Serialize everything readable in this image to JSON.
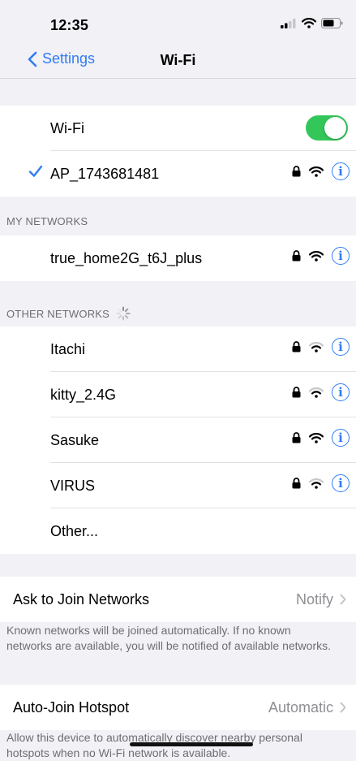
{
  "status_bar": {
    "time": "12:35"
  },
  "nav": {
    "back_label": "Settings",
    "title": "Wi-Fi"
  },
  "wifi": {
    "label": "Wi-Fi",
    "enabled": true
  },
  "connected": {
    "name": "AP_1743681481",
    "secured": true
  },
  "my_networks": {
    "header": "MY NETWORKS",
    "items": [
      {
        "name": "true_home2G_t6J_plus",
        "secured": true
      }
    ]
  },
  "other_networks": {
    "header": "OTHER NETWORKS",
    "items": [
      {
        "name": "Itachi",
        "secured": true
      },
      {
        "name": "kitty_2.4G",
        "secured": true
      },
      {
        "name": "Sasuke",
        "secured": true
      },
      {
        "name": "VIRUS",
        "secured": true
      }
    ],
    "other_label": "Other..."
  },
  "ask_to_join": {
    "label": "Ask to Join Networks",
    "value": "Notify",
    "footnote": "Known networks will be joined automatically. If no known networks are available, you will be notified of available networks."
  },
  "auto_join": {
    "label": "Auto-Join Hotspot",
    "value": "Automatic",
    "footnote": "Allow this device to automatically discover nearby personal hotspots when no Wi-Fi network is available."
  },
  "colors": {
    "accent": "#2f7cf6",
    "toggle_on": "#33c759",
    "background": "#f2f1f6"
  }
}
